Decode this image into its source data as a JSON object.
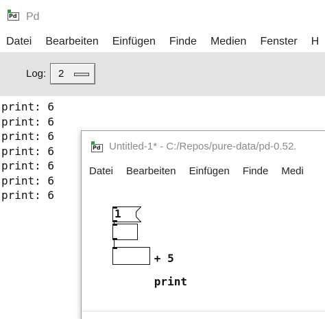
{
  "main_window": {
    "title": "Pd",
    "icon_text": "Pd",
    "menu": [
      "Datei",
      "Bearbeiten",
      "Einfügen",
      "Finde",
      "Medien",
      "Fenster",
      "H"
    ],
    "log_label": "Log:",
    "log_value": "2",
    "console_lines": [
      "print: 6",
      "print: 6",
      "print: 6",
      "print: 6",
      "print: 6",
      "print: 6",
      "print: 6"
    ]
  },
  "patch_window": {
    "title": "Untitled-1* - C:/Repos/pure-data/pd-0.52.",
    "icon_text": "Pd",
    "menu": [
      "Datei",
      "Bearbeiten",
      "Einfügen",
      "Finde",
      "Medi"
    ],
    "objects": {
      "message": "1",
      "add": "+ 5",
      "print": "print"
    }
  }
}
